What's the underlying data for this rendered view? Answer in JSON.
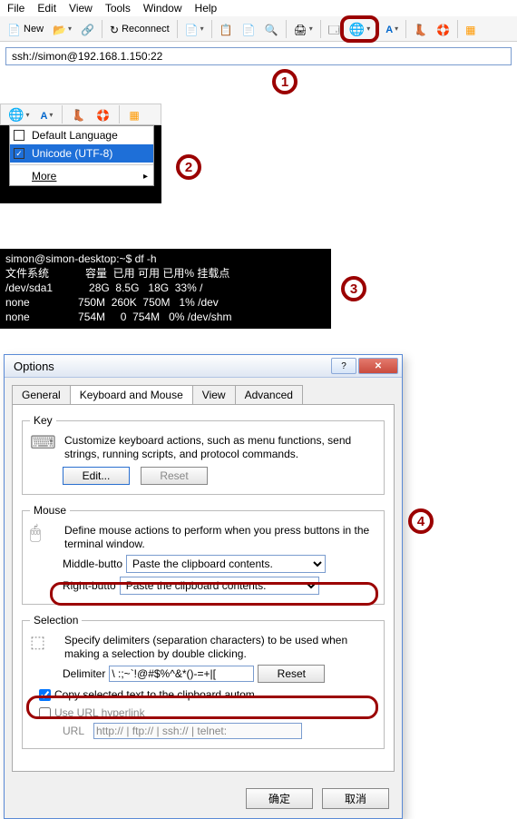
{
  "menubar": [
    "File",
    "Edit",
    "View",
    "Tools",
    "Window",
    "Help"
  ],
  "toolbar": {
    "new_label": "New",
    "reconnect_label": "Reconnect"
  },
  "address": {
    "value": "ssh://simon@192.168.1.150:22"
  },
  "badges": {
    "b1": "1",
    "b2": "2",
    "b3": "3",
    "b4": "4"
  },
  "encoding_menu": {
    "items": [
      {
        "label": "Default Language",
        "checked": false,
        "selected": false
      },
      {
        "label": "Unicode (UTF-8)",
        "checked": true,
        "selected": true
      }
    ],
    "more": "More"
  },
  "terminal": {
    "prompt": "simon@simon-desktop:~$ df -h",
    "header": "文件系统            容量  已用 可用 已用% 挂载点",
    "rows": [
      "/dev/sda1            28G  8.5G   18G  33% /",
      "none                750M  260K  750M   1% /dev",
      "none                754M     0  754M   0% /dev/shm"
    ]
  },
  "dialog": {
    "title": "Options",
    "tabs": [
      "General",
      "Keyboard and Mouse",
      "View",
      "Advanced"
    ],
    "active_tab": 1,
    "key": {
      "legend": "Key",
      "text": "Customize keyboard actions, such as menu functions, send strings, running scripts,  and protocol commands.",
      "edit": "Edit...",
      "reset": "Reset"
    },
    "mouse": {
      "legend": "Mouse",
      "text": "Define mouse actions to perform when you press buttons in the terminal window.",
      "middle_label": "Middle-butto",
      "middle_value": "Paste the clipboard contents.",
      "right_label": "Right-butto",
      "right_value": "Paste the clipboard contents."
    },
    "selection": {
      "legend": "Selection",
      "text": "Specify delimiters (separation characters) to be used when making a selection by double clicking.",
      "delim_label": "Delimiter",
      "delim_value": "\\ :;~`!@#$%^&*()-=+|[",
      "reset": "Reset",
      "copy_label": "Copy selected text to the clipboard autom",
      "hyperlink_label": "Use URL hyperlink",
      "url_label": "URL",
      "url_value": "http:// | ftp:// | ssh:// | telnet:"
    },
    "footer": {
      "ok": "确定",
      "cancel": "取消"
    }
  }
}
